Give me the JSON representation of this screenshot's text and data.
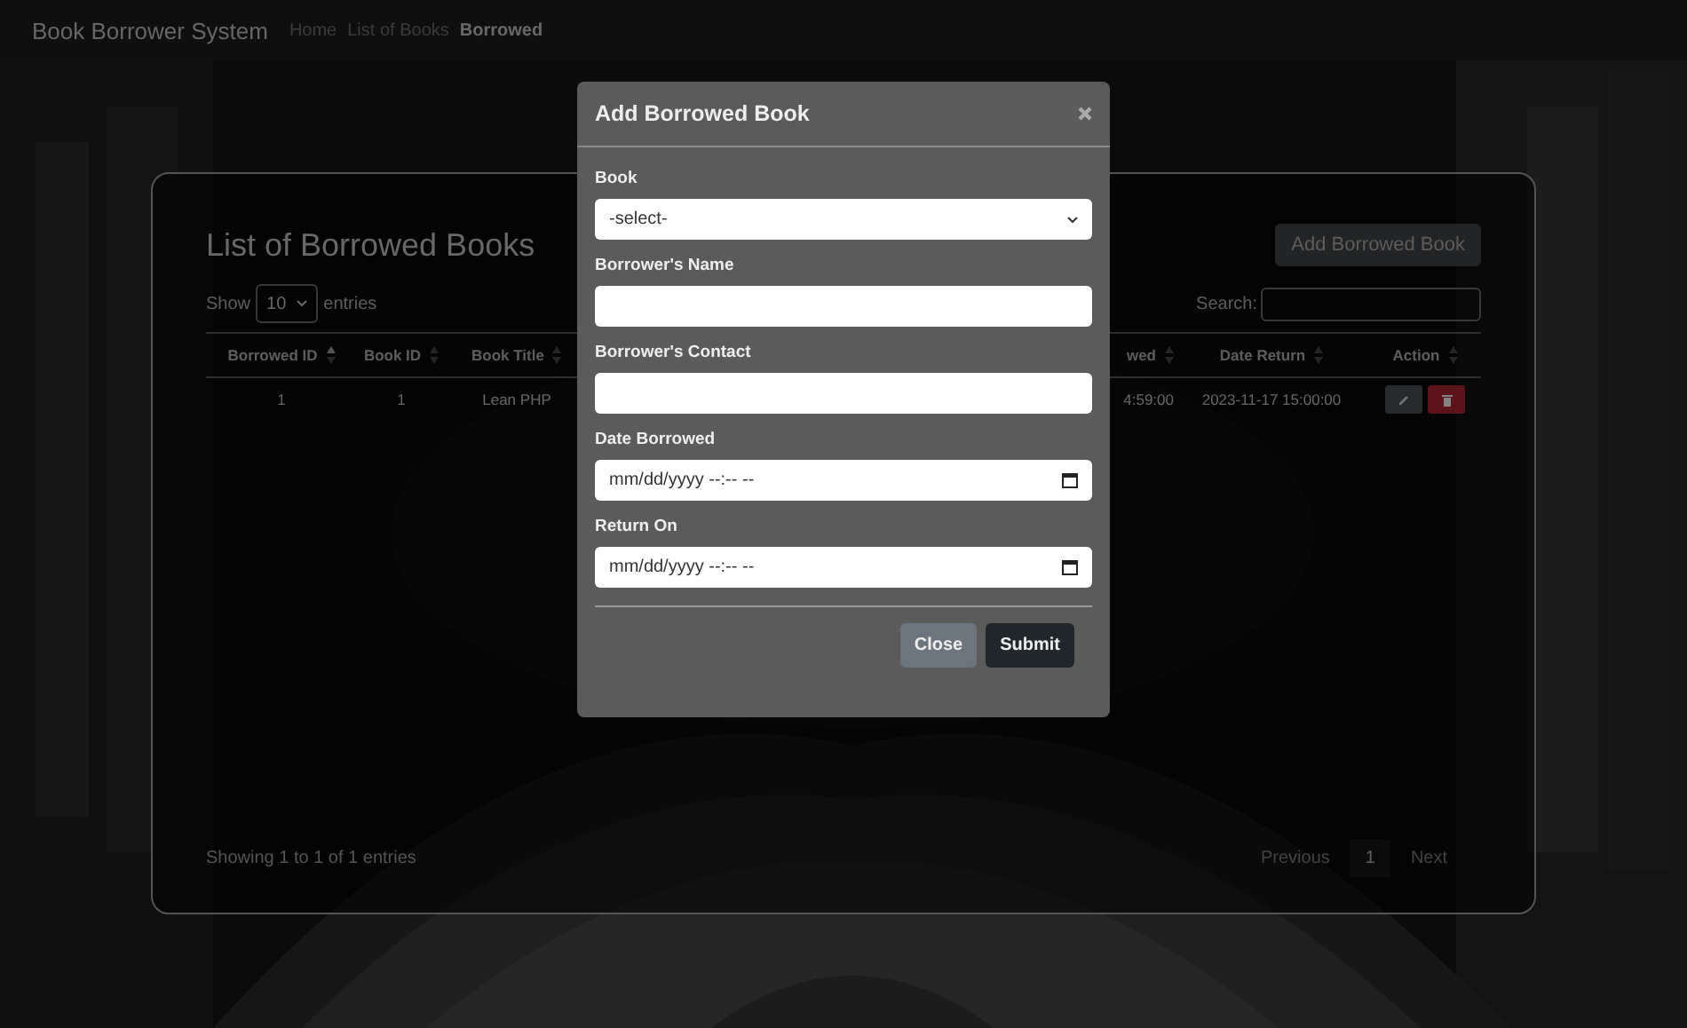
{
  "nav": {
    "brand": "Book Borrower System",
    "links": [
      {
        "label": "Home",
        "selected": false
      },
      {
        "label": "List of Books",
        "selected": false
      },
      {
        "label": "Borrowed",
        "selected": true
      }
    ]
  },
  "card": {
    "title": "List of Borrowed Books",
    "add_button": "Add Borrowed Book",
    "length": {
      "show": "Show",
      "value": "10",
      "entries": "entries"
    },
    "search": {
      "label": "Search:"
    },
    "table": {
      "columns": [
        {
          "label": "Borrowed ID",
          "sorted": true
        },
        {
          "label": "Book ID",
          "sorted": false
        },
        {
          "label": "Book Title",
          "sorted": false
        },
        {
          "label": "wed",
          "sorted": false
        },
        {
          "label": "Date Return",
          "sorted": false
        },
        {
          "label": "Action",
          "sorted": false
        }
      ],
      "rows": [
        {
          "cells": [
            "1",
            "1",
            "Lean PHP",
            "4:59:00",
            "2023-11-17 15:00:00"
          ]
        }
      ]
    },
    "info": "Showing 1 to 1 of 1 entries",
    "pagination": {
      "previous": "Previous",
      "pages": [
        {
          "label": "1",
          "selected": true
        }
      ],
      "next": "Next"
    }
  },
  "modal": {
    "title": "Add Borrowed Book",
    "fields": [
      {
        "kind": "select",
        "label": "Book",
        "value": "-select-"
      },
      {
        "kind": "text",
        "label": "Borrower's Name"
      },
      {
        "kind": "text",
        "label": "Borrower's Contact"
      },
      {
        "kind": "datetime",
        "label": "Date Borrowed",
        "placeholder": "mm/dd/yyyy --:-- --"
      },
      {
        "kind": "datetime",
        "label": "Return On",
        "placeholder": "mm/dd/yyyy --:-- --"
      }
    ],
    "buttons": [
      {
        "label": "Close",
        "kind": "secondary"
      },
      {
        "label": "Submit",
        "kind": "dark"
      }
    ]
  }
}
